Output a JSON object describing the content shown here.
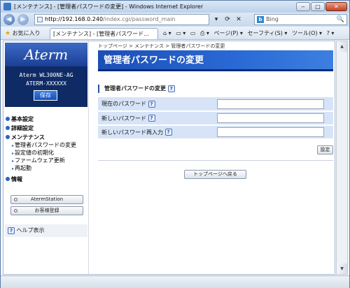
{
  "window": {
    "title": "[メンテナンス] - [管理者パスワードの変更] - Windows Internet Explorer",
    "min_glyph": "‒",
    "max_glyph": "□",
    "close_glyph": "✕"
  },
  "addressbar": {
    "back_glyph": "◀",
    "forward_glyph": "▶",
    "host": "http://192.168.0.240",
    "path": "/index.cgi/password_main",
    "search_engine": "Bing",
    "search_placeholder": "Bing",
    "tools": [
      "▾",
      "⟳",
      "✕"
    ],
    "search_icon": "🔍"
  },
  "favorites": {
    "label": "お気に入り",
    "tab_title": "[メンテナンス] - [管理者パスワード...",
    "commands": [
      "⌂ ▾",
      "▭ ▾",
      "▭",
      "⎙ ▾",
      "ページ(P) ▾",
      "セーフティ(S) ▾",
      "ツール(O) ▾",
      "? ▾"
    ]
  },
  "sidebar": {
    "logo": "Aterm",
    "model_line1": "Aterm WL300NE-AG",
    "model_line2": "ATERM-XXXXXX",
    "save_label": "保存",
    "menu": {
      "basic": "基本設定",
      "detail": "詳細設定",
      "maint": "メンテナンス",
      "maint_items": [
        "管理者パスワードの変更",
        "設定値の初期化",
        "ファームウェア更新",
        "再起動"
      ],
      "info": "情報"
    },
    "btn_station": "AtermStation",
    "btn_register": "お客様登録",
    "help": "ヘルプ表示"
  },
  "main": {
    "breadcrumb": "トップページ > メンテナンス > 管理者パスワードの変更",
    "heading": "管理者パスワードの変更",
    "section": "管理者パスワードの変更",
    "fields": [
      "現在のパスワード",
      "新しいパスワード",
      "新しいパスワード再入力"
    ],
    "set_label": "設定",
    "top_label": "トップページへ戻る"
  },
  "colors": {
    "heading_bg": "#2a6ad6",
    "sidebar_bg": "#0f2b66",
    "table_bg": "#d7e4f7"
  }
}
